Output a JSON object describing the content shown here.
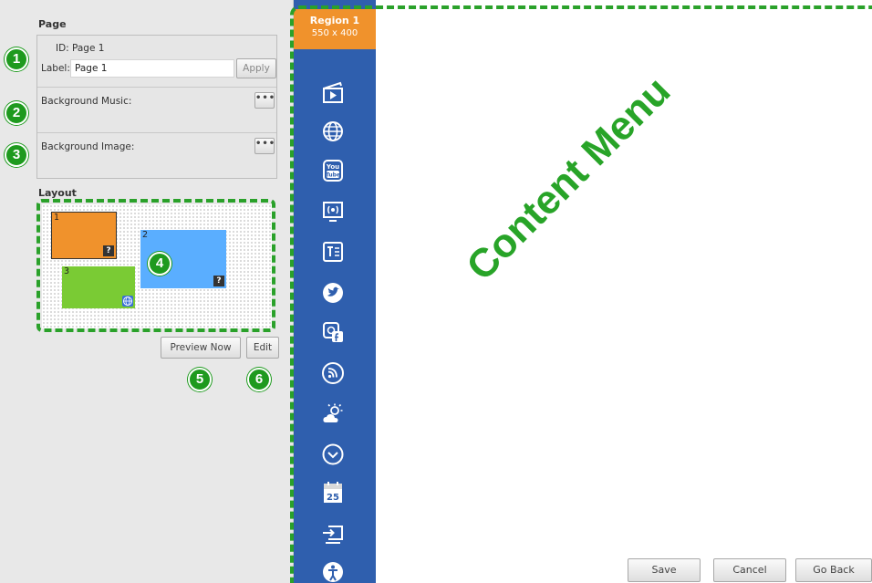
{
  "page_panel": {
    "title": "Page",
    "id_label": "ID:",
    "id_value": "Page 1",
    "label_label": "Label:",
    "label_value": "Page 1",
    "apply_button": "Apply",
    "bg_music_label": "Background Music:",
    "bg_image_label": "Background Image:",
    "browse_button": "•••"
  },
  "layout_panel": {
    "title": "Layout",
    "regions": [
      {
        "number": "1",
        "color": "#f0922c",
        "badge": "?"
      },
      {
        "number": "2",
        "color": "#5aaeff",
        "badge": "?"
      },
      {
        "number": "3",
        "color": "#7acb34",
        "badge": "globe-icon"
      }
    ],
    "preview_button": "Preview Now",
    "edit_button": "Edit"
  },
  "markers": [
    "1",
    "2",
    "3",
    "4",
    "5",
    "6"
  ],
  "region_tab": {
    "title": "Region 1",
    "size": "550 x 400"
  },
  "content_menu": {
    "overlay_label": "Content Menu",
    "icons": [
      "video-icon",
      "web-icon",
      "youtube-icon",
      "live-stream-icon",
      "text-icon",
      "twitter-icon",
      "social-feed-icon",
      "rss-icon",
      "weather-icon",
      "clock-icon",
      "calendar-icon",
      "input-source-icon",
      "accessibility-icon"
    ],
    "calendar_day": "25",
    "youtube_text": "You Tube"
  },
  "footer": {
    "save": "Save",
    "cancel": "Cancel",
    "go_back": "Go Back"
  },
  "colors": {
    "accent_green": "#2aa12a",
    "strip_blue": "#2f5fae",
    "region_orange": "#f0922c"
  }
}
